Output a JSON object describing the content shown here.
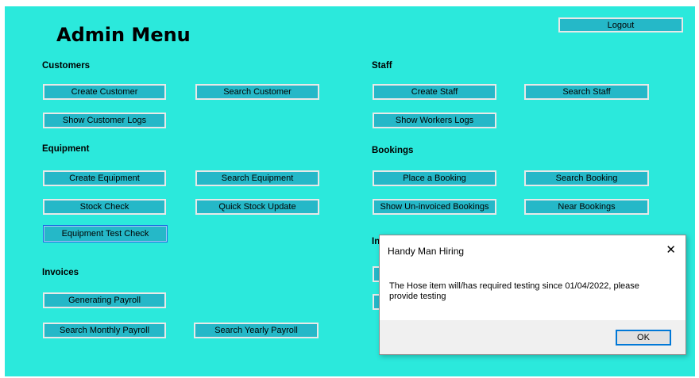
{
  "title": "Admin Menu",
  "logout": "Logout",
  "customers": {
    "heading": "Customers",
    "create": "Create Customer",
    "search": "Search Customer",
    "logs": "Show Customer Logs"
  },
  "staff": {
    "heading": "Staff",
    "create": "Create Staff",
    "search": "Search Staff",
    "logs": "Show Workers Logs"
  },
  "equipment": {
    "heading": "Equipment",
    "create": "Create Equipment",
    "search": "Search Equipment",
    "stock": "Stock Check",
    "quick": "Quick Stock Update",
    "test": "Equipment Test Check"
  },
  "bookings": {
    "heading": "Bookings",
    "place": "Place a Booking",
    "search": "Search Booking",
    "uninvoiced": "Show Un-invoiced Bookings",
    "near": "Near Bookings"
  },
  "invoices": {
    "heading": "Invoices",
    "payroll": "Generating Payroll",
    "monthly": "Search Monthly Payroll",
    "yearly": "Search Yearly Payroll"
  },
  "hidden_section_fragment": "In",
  "dialog": {
    "title": "Handy Man Hiring",
    "close": "✕",
    "message": "The Hose item will/has required testing since 01/04/2022, please provide testing",
    "ok": "OK"
  },
  "colors": {
    "form_bg": "#2be9dc",
    "button_bg": "#25b8c8",
    "focus_border": "#1a6fe0"
  }
}
